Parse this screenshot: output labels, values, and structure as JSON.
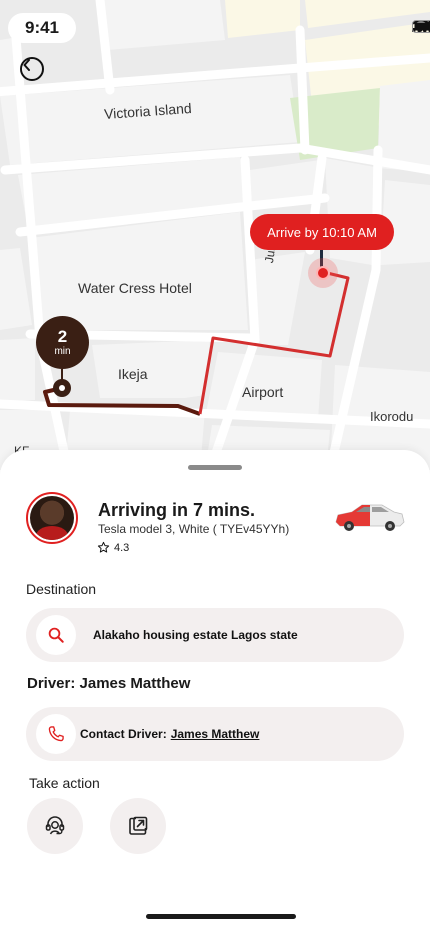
{
  "status_bar": {
    "time": "9:41"
  },
  "map": {
    "labels": {
      "victoria_island": "Victoria Island",
      "water_cress_hotel": "Water Cress Hotel",
      "ikeja": "Ikeja",
      "airport": "Airport",
      "ikorodu": "Ikorodu",
      "julius": "Julius B",
      "kf": "KF"
    },
    "arrive_pill": "Arrive by 10:10 AM",
    "eta_badge": {
      "value": "2",
      "unit": "min"
    }
  },
  "trip": {
    "title": "Arriving in 7 mins.",
    "car_description": "Tesla model 3, White ( TYEv45YYh)",
    "rating": "4.3"
  },
  "destination": {
    "label": "Destination",
    "address": "Alakaho housing estate Lagos state"
  },
  "driver": {
    "title": "Driver: James Matthew",
    "contact_prefix": "Contact Driver:",
    "contact_name": "James Matthew"
  },
  "actions": {
    "label": "Take action",
    "items": [
      {
        "icon": "support-agent-icon"
      },
      {
        "icon": "share-external-icon"
      }
    ]
  },
  "colors": {
    "accent": "#e02020",
    "route": "#d32f2f",
    "route_dark": "#5a1a0e",
    "badge": "#3a1f14",
    "pill_bg": "#f3efef",
    "park": "#d9ebc9"
  }
}
